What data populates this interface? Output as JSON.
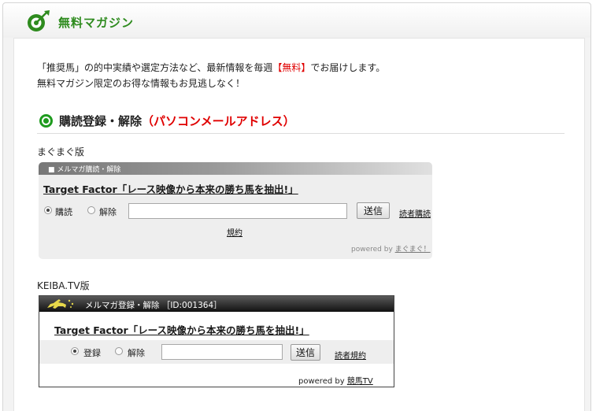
{
  "header": {
    "title": "無料マガジン",
    "icon": "target-arrow-icon"
  },
  "intro": {
    "line1_pre": "「推奨馬」の的中実績や選定方法など、最新情報を毎週",
    "line1_red": "【無料】",
    "line1_post": "でお届けします。",
    "line2": "無料マガジン限定のお得な情報もお見逃しなく！"
  },
  "section": {
    "title": "購読登録・解除",
    "subtitle": "（パソコンメールアドレス）"
  },
  "mag2": {
    "version_label": "まぐまぐ版",
    "bar_text": "■ メルマガ購読・解除",
    "title": "Target Factor「レース映像から本来の勝ち馬を抽出!」",
    "radio_subscribe": "購読",
    "radio_unsubscribe": "解除",
    "email_value": "",
    "submit_label": "送信",
    "reader_link": "読者購読",
    "terms_link": "規約",
    "powered_prefix": "powered by ",
    "powered_link": "まぐまぐ！"
  },
  "keiba": {
    "version_label": "KEIBA.TV版",
    "bar_text": "メルマガ登録・解除 ［ID:001364］",
    "title": "Target Factor「レース映像から本来の勝ち馬を抽出!」",
    "radio_register": "登録",
    "radio_unsubscribe": "解除",
    "email_value": "",
    "submit_label": "送信",
    "terms_link": "読者規約",
    "powered_prefix": "powered by ",
    "powered_link": "競馬TV"
  },
  "colors": {
    "brand_green": "#2e8b1e",
    "accent_red": "#e00000"
  }
}
